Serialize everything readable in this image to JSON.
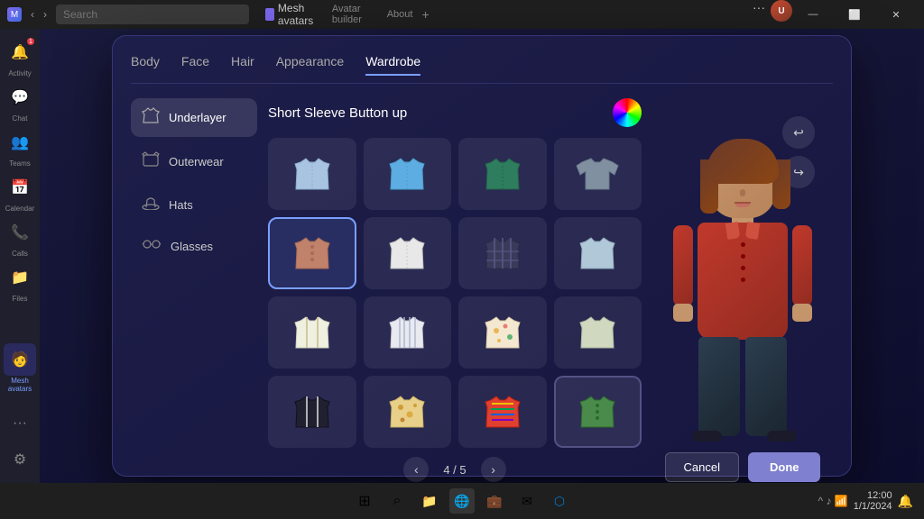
{
  "titlebar": {
    "app_name": "Mesh avatars",
    "tab1": "Avatar builder",
    "tab2": "About",
    "search_placeholder": "Search"
  },
  "sidebar": {
    "items": [
      {
        "id": "activity",
        "label": "Activity",
        "icon": "🔔",
        "badge": true
      },
      {
        "id": "chat",
        "label": "Chat",
        "icon": "💬",
        "badge": false
      },
      {
        "id": "teams",
        "label": "Teams",
        "icon": "👥",
        "badge": false
      },
      {
        "id": "calendar",
        "label": "Calendar",
        "icon": "📅",
        "badge": false
      },
      {
        "id": "calls",
        "label": "Calls",
        "icon": "📞",
        "badge": false
      },
      {
        "id": "files",
        "label": "Files",
        "icon": "📁",
        "badge": false
      },
      {
        "id": "mesh",
        "label": "Mesh avatars",
        "icon": "🧑‍💻",
        "active": true
      }
    ]
  },
  "modal": {
    "tabs": [
      "Body",
      "Face",
      "Hair",
      "Appearance",
      "Wardrobe"
    ],
    "active_tab": "Wardrobe",
    "categories": [
      {
        "id": "underlayer",
        "label": "Underlayer",
        "icon": "👕",
        "active": true
      },
      {
        "id": "outerwear",
        "label": "Outerwear",
        "icon": "🧥"
      },
      {
        "id": "hats",
        "label": "Hats",
        "icon": "🎩"
      },
      {
        "id": "glasses",
        "label": "Glasses",
        "icon": "👓"
      }
    ],
    "items_title": "Short Sleeve Button up",
    "pagination": {
      "current": 4,
      "total": 5,
      "label": "4 / 5"
    },
    "selected_item": 4,
    "items": [
      {
        "id": 1,
        "color": "#a8c4e0",
        "type": "button-shirt"
      },
      {
        "id": 2,
        "color": "#5dade2",
        "type": "button-shirt"
      },
      {
        "id": 3,
        "color": "#2e7d5e",
        "type": "button-shirt"
      },
      {
        "id": 4,
        "color": "#8090a0",
        "type": "long-shirt"
      },
      {
        "id": 5,
        "color": "#c0826b",
        "type": "polo",
        "selected": true
      },
      {
        "id": 6,
        "color": "#e0e0e0",
        "type": "dress-shirt"
      },
      {
        "id": 7,
        "color": "#3a3a5a",
        "type": "plaid"
      },
      {
        "id": 8,
        "color": "#b0c8d8",
        "type": "casual"
      },
      {
        "id": 9,
        "color": "#f0f0e0",
        "type": "stripe-shirt"
      },
      {
        "id": 10,
        "color": "#e8eaf0",
        "type": "stripe-shirt2"
      },
      {
        "id": 11,
        "color": "#f5e8d0",
        "type": "hawaiian"
      },
      {
        "id": 12,
        "color": "#d0d8c0",
        "type": "casual2"
      },
      {
        "id": 13,
        "color": "#202030",
        "type": "dark-stripe"
      },
      {
        "id": 14,
        "color": "#e8d08a",
        "type": "floral"
      },
      {
        "id": 15,
        "color": "#e04030",
        "type": "colorful"
      },
      {
        "id": 16,
        "color": "#4a8a4a",
        "type": "green-shirt",
        "dark_selected": true
      }
    ],
    "buttons": {
      "cancel": "Cancel",
      "done": "Done"
    }
  },
  "taskbar": {
    "time": "12:00",
    "date": "1/1/2024"
  },
  "icons": {
    "undo": "↩",
    "redo": "↪",
    "prev": "‹",
    "next": "›",
    "windows": "⊞",
    "search": "⌕"
  }
}
